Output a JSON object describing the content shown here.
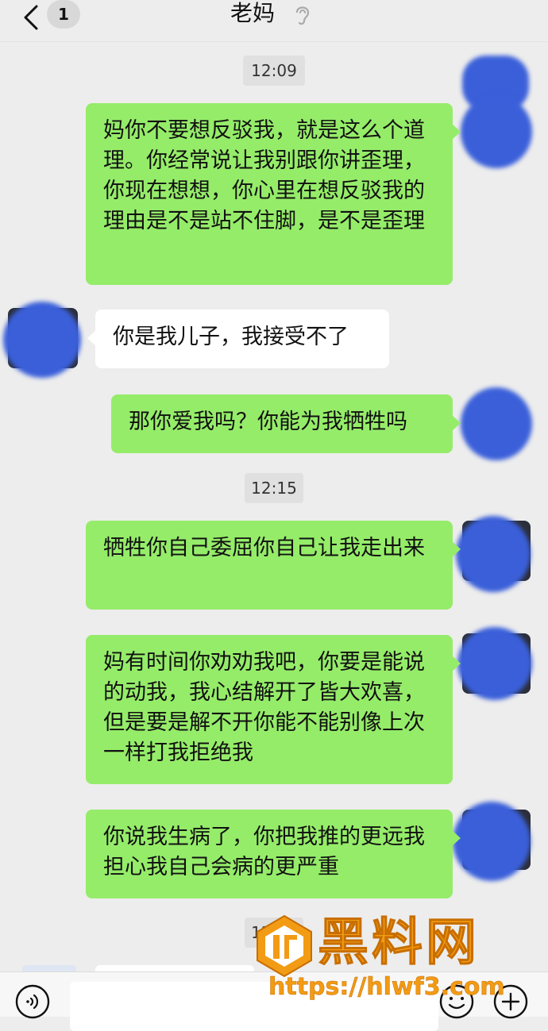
{
  "header": {
    "title": "老妈",
    "unread_count": "1"
  },
  "messages": {
    "t1": "12:09",
    "m1": "妈你不要想反驳我，就是这么个道理。你经常说让我别跟你讲歪理，你现在想想，你心里在想反驳我的理由是不是站不住脚，是不是歪理",
    "m2": "你是我儿子，我接受不了",
    "m3": "那你爱我吗？你能为我牺牲吗",
    "t2": "12:15",
    "m4": "牺牲你自己委屈你自己让我走出来",
    "m5": "妈有时间你劝劝我吧，你要是能说的动我，我心结解开了皆大欢喜，但是要是解不开你能不能别像上次一样打我拒绝我",
    "m6": "你说我生病了，你把我推的更远我担心我自己会病的更严重",
    "t3": "12:13"
  },
  "colors": {
    "background": "#ededed",
    "my_bubble": "#95ec69",
    "their_bubble": "#ffffff",
    "avatar_cover": "#3a5fd9",
    "watermark": "#f29b14"
  },
  "icons": {
    "back": "chevron-left-icon",
    "ear": "ear-icon",
    "voice": "voice-icon",
    "emoji": "emoji-icon",
    "plus": "plus-icon"
  },
  "watermark": {
    "title": "黑料网",
    "url": "https://hlwf3.com"
  }
}
